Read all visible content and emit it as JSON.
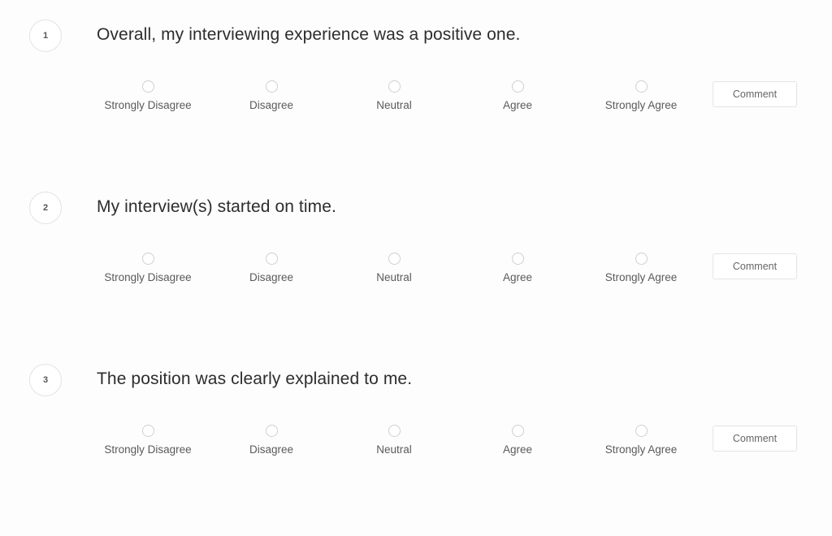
{
  "survey": {
    "questions": [
      {
        "number": "1",
        "text": "Overall, my interviewing experience was a positive one.",
        "options": [
          "Strongly Disagree",
          "Disagree",
          "Neutral",
          "Agree",
          "Strongly Agree"
        ],
        "selected": null,
        "comment_label": "Comment"
      },
      {
        "number": "2",
        "text": "My interview(s) started on time.",
        "options": [
          "Strongly Disagree",
          "Disagree",
          "Neutral",
          "Agree",
          "Strongly Agree"
        ],
        "selected": null,
        "comment_label": "Comment"
      },
      {
        "number": "3",
        "text": "The position was clearly explained to me.",
        "options": [
          "Strongly Disagree",
          "Disagree",
          "Neutral",
          "Agree",
          "Strongly Agree"
        ],
        "selected": null,
        "comment_label": "Comment"
      }
    ]
  }
}
